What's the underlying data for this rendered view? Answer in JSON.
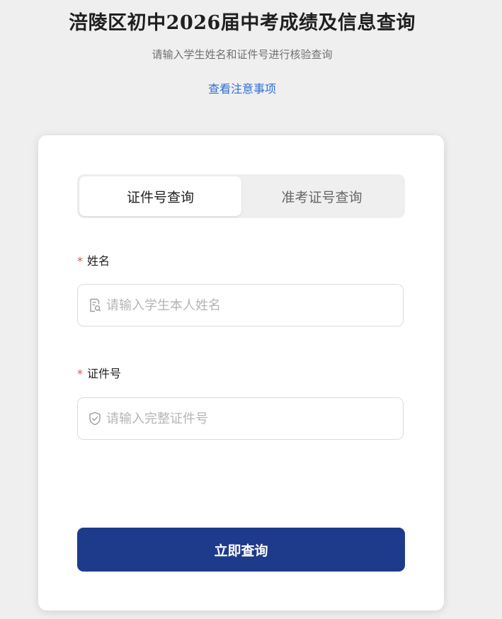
{
  "header": {
    "title": "涪陵区初中2026届中考成绩及信息查询",
    "subtitle": "请输入学生姓名和证件号进行核验查询",
    "notice_link": "查看注意事项"
  },
  "tabs": [
    {
      "label": "证件号查询",
      "active": true
    },
    {
      "label": "准考证号查询",
      "active": false
    }
  ],
  "form": {
    "name": {
      "required_mark": "*",
      "label": "姓名",
      "placeholder": "请输入学生本人姓名",
      "value": "",
      "icon": "id-card-search-icon"
    },
    "id_number": {
      "required_mark": "*",
      "label": "证件号",
      "placeholder": "请输入完整证件号",
      "value": "",
      "icon": "shield-check-icon"
    },
    "submit_label": "立即查询"
  },
  "colors": {
    "primary": "#1e3a8a",
    "link": "#2f6fd6",
    "required": "#d9534f",
    "background": "#efefef"
  }
}
